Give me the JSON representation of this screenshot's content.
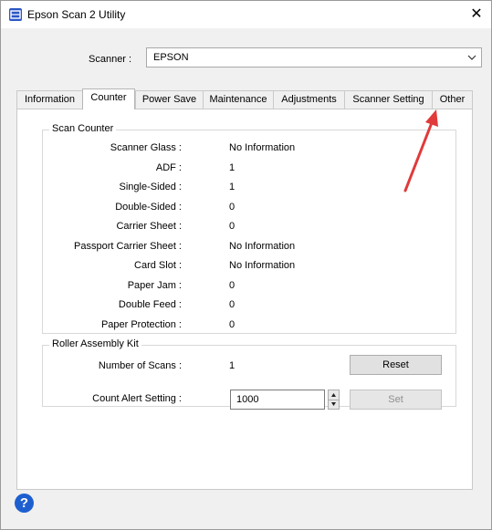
{
  "window": {
    "title": "Epson Scan 2 Utility",
    "close_glyph": "✕"
  },
  "scanner": {
    "label": "Scanner :",
    "value": "EPSON"
  },
  "tabs": [
    {
      "label": "Information",
      "active": false
    },
    {
      "label": "Counter",
      "active": true
    },
    {
      "label": "Power Save",
      "active": false
    },
    {
      "label": "Maintenance",
      "active": false
    },
    {
      "label": "Adjustments",
      "active": false
    },
    {
      "label": "Scanner Setting",
      "active": false
    },
    {
      "label": "Other",
      "active": false
    }
  ],
  "scan_counter": {
    "title": "Scan Counter",
    "rows": [
      {
        "label": "Scanner Glass :",
        "value": "No Information"
      },
      {
        "label": "ADF :",
        "value": "1"
      },
      {
        "label": "Single-Sided :",
        "value": "1"
      },
      {
        "label": "Double-Sided :",
        "value": "0"
      },
      {
        "label": "Carrier Sheet :",
        "value": "0"
      },
      {
        "label": "Passport Carrier Sheet :",
        "value": "No Information"
      },
      {
        "label": "Card Slot :",
        "value": "No Information"
      },
      {
        "label": "Paper Jam :",
        "value": "0"
      },
      {
        "label": "Double Feed :",
        "value": "0"
      },
      {
        "label": "Paper Protection :",
        "value": "0"
      }
    ]
  },
  "roller_kit": {
    "title": "Roller Assembly Kit",
    "scans_label": "Number of Scans :",
    "scans_value": "1",
    "reset_label": "Reset",
    "alert_label": "Count Alert Setting :",
    "alert_value": "1000",
    "set_label": "Set"
  },
  "help": {
    "glyph": "?"
  },
  "colors": {
    "accent": "#1e5fd0",
    "annotation_arrow": "#e03a3a"
  },
  "icons": [
    "app-icon",
    "close-icon",
    "chevron-down-icon",
    "spin-up-icon",
    "spin-down-icon",
    "help-icon"
  ]
}
